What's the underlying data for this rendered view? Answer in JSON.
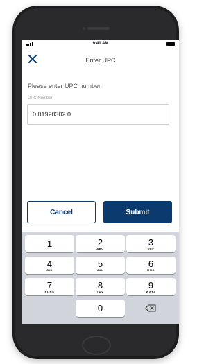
{
  "status_bar": {
    "time": "9:41 AM"
  },
  "nav": {
    "title": "Enter UPC",
    "close_icon": "close-icon"
  },
  "form": {
    "prompt": "Please enter UPC number",
    "field_label": "UPC Number",
    "field_value": "0 01920302 0"
  },
  "actions": {
    "cancel_label": "Cancel",
    "submit_label": "Submit"
  },
  "keypad": {
    "keys": [
      {
        "digit": "1",
        "letters": ""
      },
      {
        "digit": "2",
        "letters": "ABC"
      },
      {
        "digit": "3",
        "letters": "DEF"
      },
      {
        "digit": "4",
        "letters": "GHI"
      },
      {
        "digit": "5",
        "letters": "JKL"
      },
      {
        "digit": "6",
        "letters": "MNO"
      },
      {
        "digit": "7",
        "letters": "PQRS"
      },
      {
        "digit": "8",
        "letters": "TUV"
      },
      {
        "digit": "9",
        "letters": "WXYZ"
      },
      {
        "digit": "0",
        "letters": ""
      }
    ],
    "backspace_icon": "backspace-icon"
  },
  "colors": {
    "primary": "#0a3a6e",
    "keypad_bg": "#d1d4da",
    "device_frame": "#1d1d1f"
  }
}
